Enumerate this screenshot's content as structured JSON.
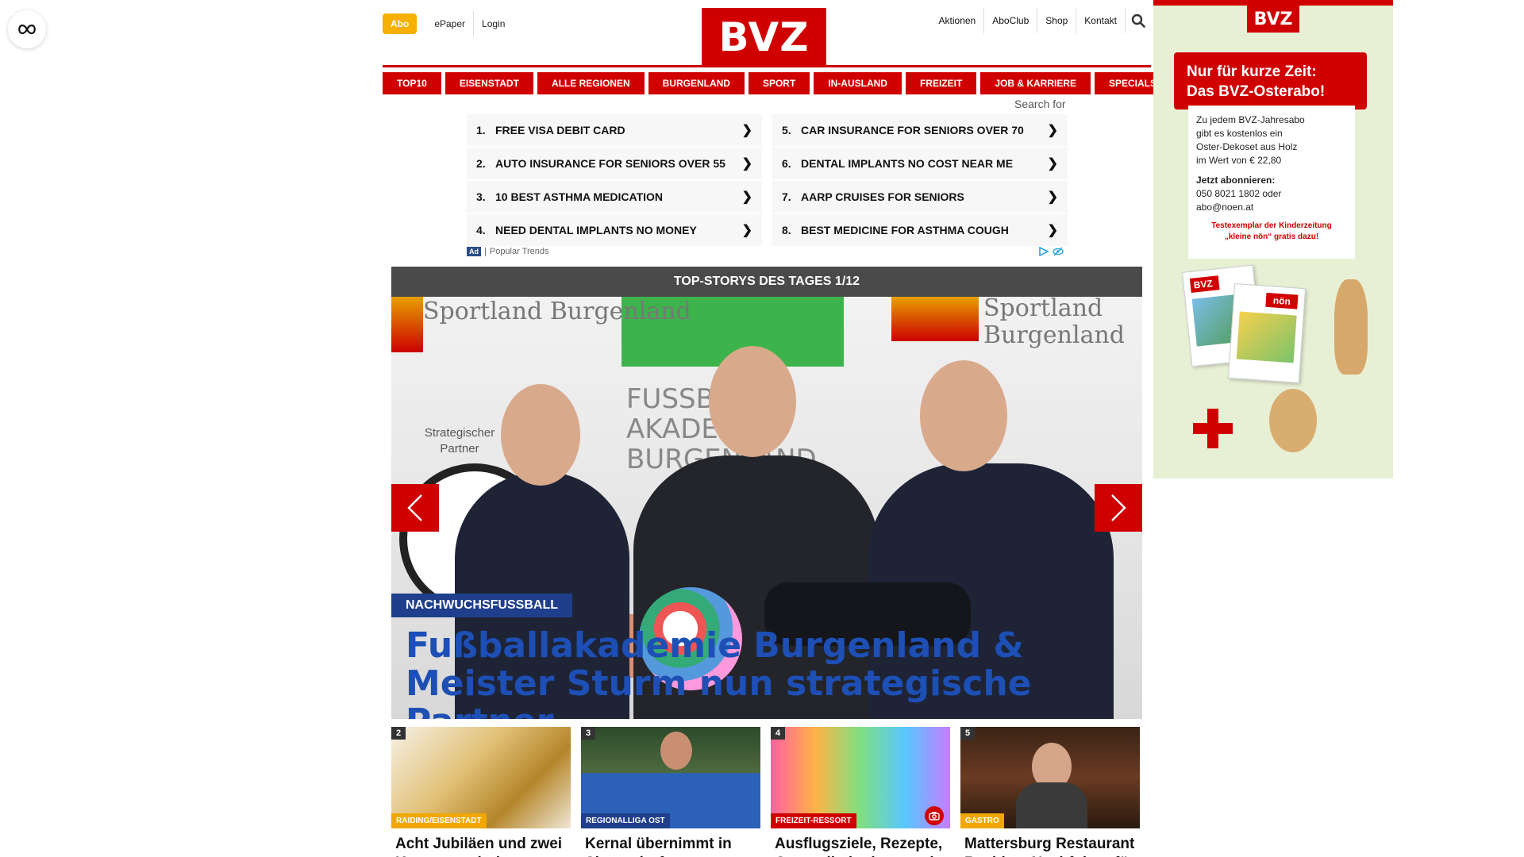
{
  "header": {
    "abo_label": "Abo",
    "epaper_label": "ePaper",
    "login_label": "Login",
    "logo_text": "BVZ",
    "right_links": [
      "Aktionen",
      "AboClub",
      "Shop",
      "Kontakt"
    ]
  },
  "nav": {
    "items": [
      "TOP10",
      "EISENSTADT",
      "ALLE REGIONEN",
      "BURGENLAND",
      "SPORT",
      "IN-AUSLAND",
      "FREIZEIT",
      "JOB & KARRIERE",
      "SPECIALS"
    ]
  },
  "search": {
    "label": "Search for"
  },
  "ads": {
    "left": [
      {
        "num": "1.",
        "text": "FREE VISA DEBIT CARD"
      },
      {
        "num": "2.",
        "text": "AUTO INSURANCE FOR SENIORS OVER 55"
      },
      {
        "num": "3.",
        "text": "10 BEST ASTHMA MEDICATION"
      },
      {
        "num": "4.",
        "text": "NEED DENTAL IMPLANTS NO MONEY"
      }
    ],
    "right": [
      {
        "num": "5.",
        "text": "CAR INSURANCE FOR SENIORS OVER 70"
      },
      {
        "num": "6.",
        "text": "DENTAL IMPLANTS NO COST NEAR ME"
      },
      {
        "num": "7.",
        "text": "AARP CRUISES FOR SENIORS"
      },
      {
        "num": "8.",
        "text": "BEST MEDICINE FOR ASTHMA COUGH"
      }
    ],
    "chevron": "❯",
    "badge": "Ad",
    "source": "Popular Trends"
  },
  "stories": {
    "heading": "TOP-STORYS DES TAGES 1/12",
    "hero": {
      "tag": "NACHWUCHSFUSSBALL",
      "title": "Fußballakademie Burgenland & Meister Sturm nun strategische Partner",
      "bg_text_left": "Sportland Burgenland",
      "bg_text_right": "Sportland Burgenland",
      "bg_partner": "Strategischer Partner",
      "bg_akademie": "FUSSBALL AKADEMIE BURGENLAND"
    },
    "cards": [
      {
        "num": "2",
        "tag": "RAIDING/EISENSTADT",
        "tag_color": "#f0a800",
        "title": "Acht Jubiläen und zwei Konzerte mit der"
      },
      {
        "num": "3",
        "tag": "REGIONALLIGA OST",
        "tag_color": "#1f3e8c",
        "title": "Kernal übernimmt in Siegendorf:"
      },
      {
        "num": "4",
        "tag": "FREIZEIT-RESSORT",
        "tag_color": "#d00000",
        "title": "Ausflugsziele, Rezepte, Gesundheitstipps und"
      },
      {
        "num": "5",
        "tag": "GASTRO",
        "tag_color": "#f0a800",
        "title": "Mattersburg Restaurant Reeblax: Nachfolger für"
      }
    ]
  },
  "side_ad": {
    "logo": "BVZ",
    "headline_1": "Nur für kurze Zeit:",
    "headline_2": "Das BVZ-Osterabo!",
    "body_1": "Zu jedem BVZ-Jahresabo",
    "body_2": "gibt es kostenlos ein",
    "body_3": "Oster-Dekoset aus Holz",
    "body_4": "im Wert von € 22,80",
    "cta": "Jetzt abonnieren:",
    "phone": "050 8021 1802 oder",
    "email": "abo@noen.at",
    "promo_1": "Testexemplar der Kinderzeitung",
    "promo_2": "„kleine nön“ gratis dazu!",
    "mag_label_1": "BVZ",
    "mag_label_2": "nön"
  },
  "colors": {
    "brand_red": "#d00000",
    "abo_yellow": "#f6b000",
    "hero_title_blue": "#1d4fb5",
    "tag_blue": "#1f3e8c"
  }
}
